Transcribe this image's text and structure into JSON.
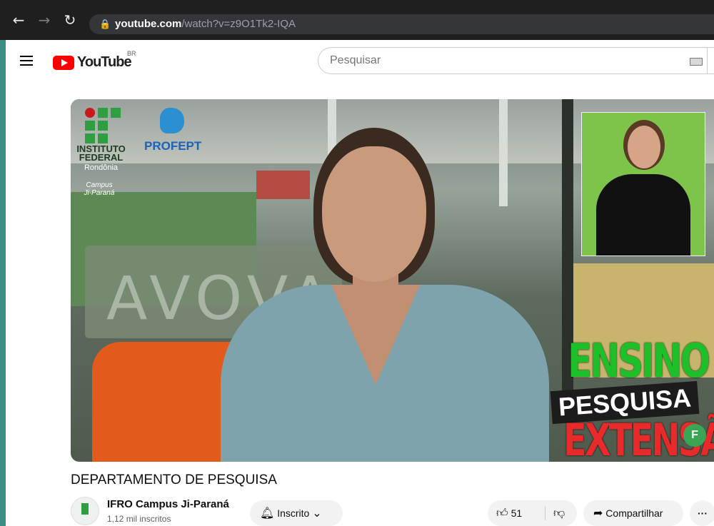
{
  "browser": {
    "url_host": "youtube.com",
    "url_path": "/watch?v=z9O1Tk2-IQA"
  },
  "header": {
    "logo_text": "YouTube",
    "country_code": "BR",
    "search_placeholder": "Pesquisar"
  },
  "video": {
    "overlay": {
      "institute_line1": "INSTITUTO",
      "institute_line2": "FEDERAL",
      "institute_state": "Rondônia",
      "campus_line1": "Campus",
      "campus_line2": "Ji-Paraná",
      "profept": "PROFEPT",
      "tag_ensino": "ENSINO",
      "tag_pesquisa": "PESQUISA",
      "tag_extensao": "EXTENSÃO",
      "background_sign": "AVOVA"
    }
  },
  "info": {
    "title": "DEPARTAMENTO DE PESQUISA",
    "channel_name": "IFRO Campus Ji-Paraná",
    "subscribers": "1,12 mil inscritos",
    "subscribe_label": "Inscrito",
    "like_count": "51",
    "share_label": "Compartilhar",
    "more_label": "···"
  }
}
